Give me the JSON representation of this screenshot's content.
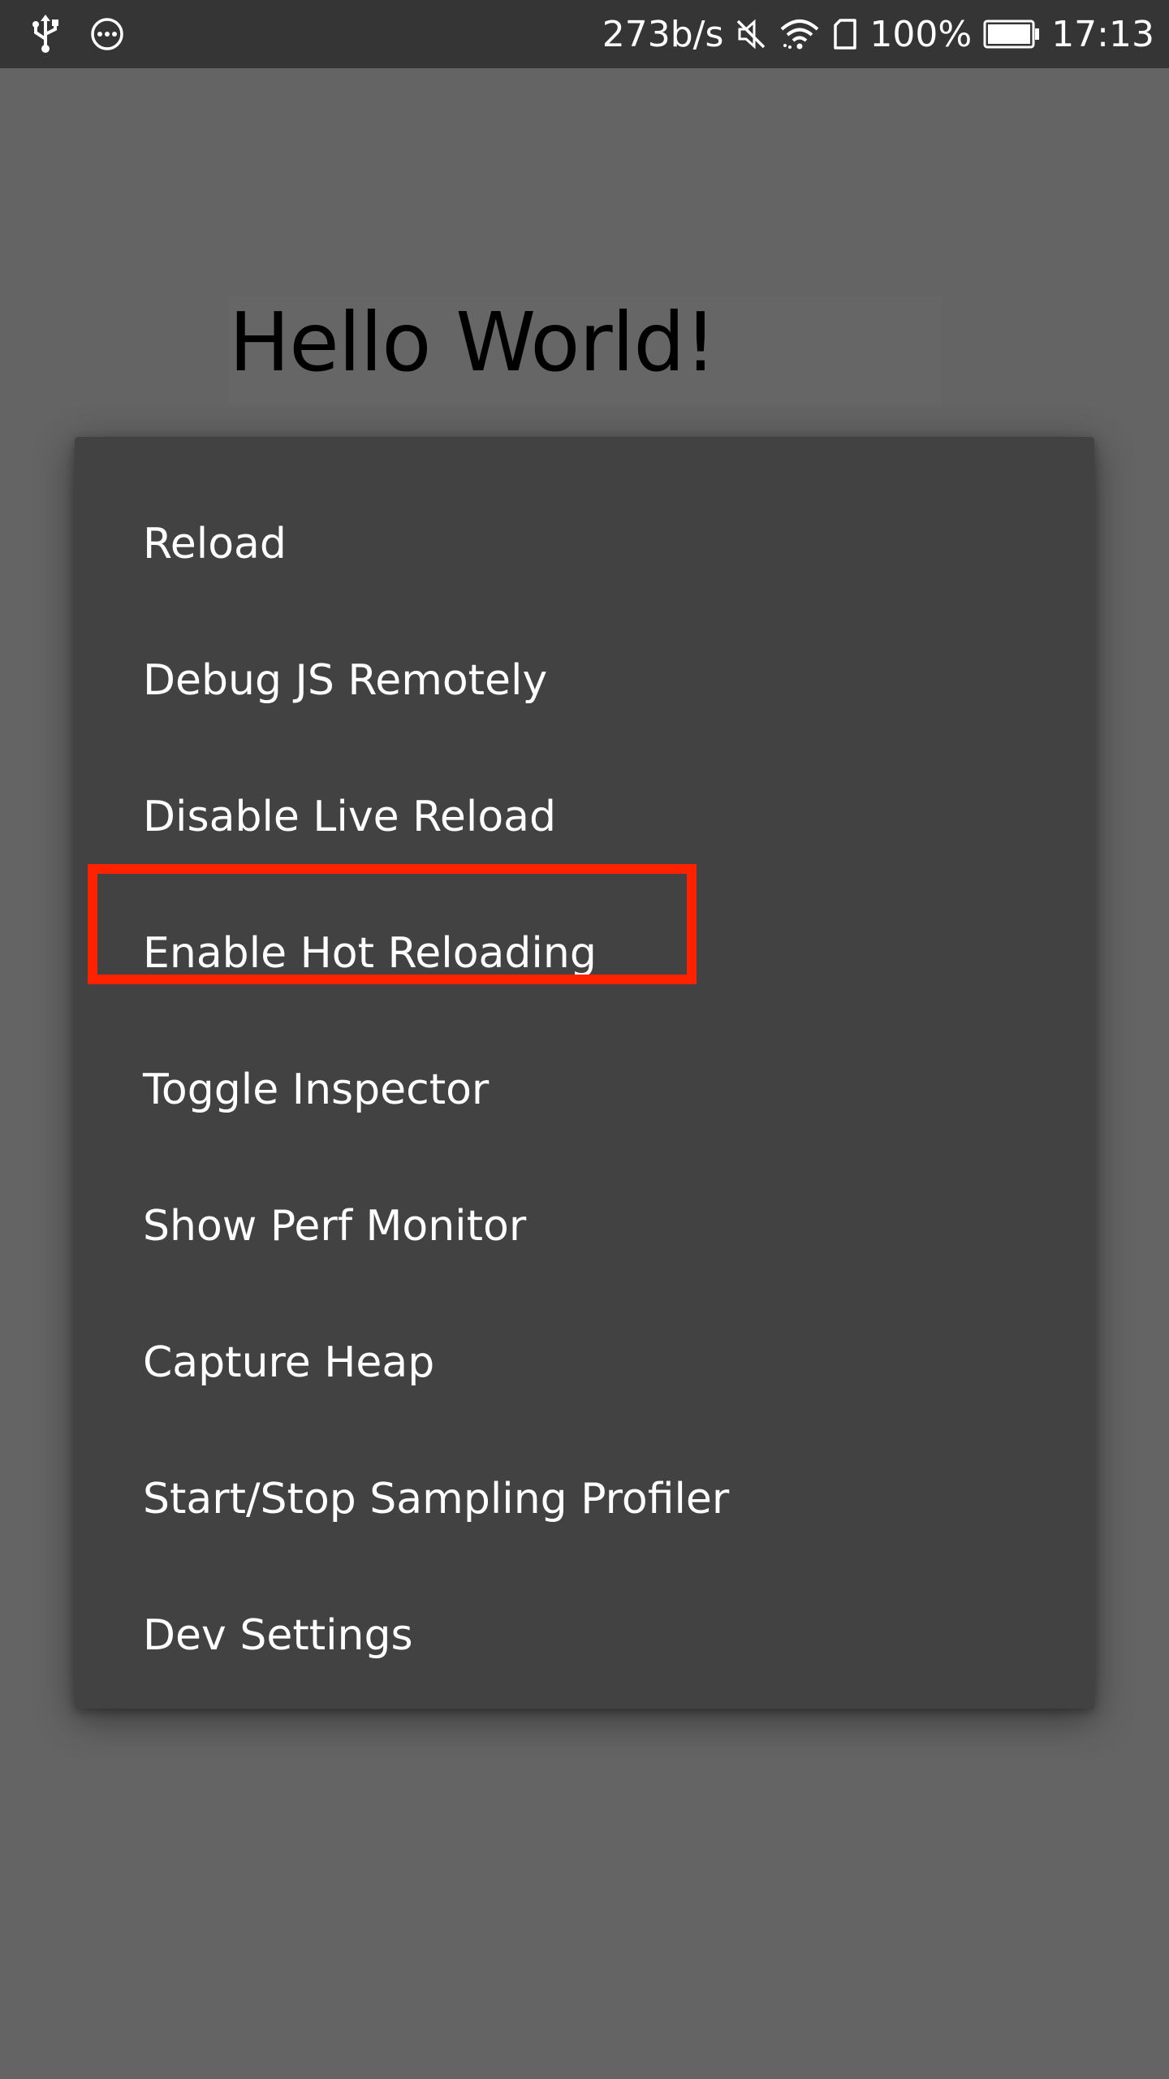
{
  "status_bar": {
    "left_icons": [
      "usb-icon",
      "more-dots-icon"
    ],
    "network_speed": "273b/s",
    "right_icons": [
      "mute-icon",
      "wifi-icon",
      "sim-card-icon"
    ],
    "battery_percent": "100%",
    "time": "17:13"
  },
  "app": {
    "title": "Hello World!"
  },
  "dev_menu": {
    "items": [
      {
        "label": "Reload"
      },
      {
        "label": "Debug JS Remotely"
      },
      {
        "label": "Disable Live Reload"
      },
      {
        "label": "Enable Hot Reloading"
      },
      {
        "label": "Toggle Inspector"
      },
      {
        "label": "Show Perf Monitor"
      },
      {
        "label": "Capture Heap"
      },
      {
        "label": "Start/Stop Sampling Profiler"
      },
      {
        "label": "Dev Settings"
      }
    ],
    "highlighted_item": "Enable Hot Reloading"
  },
  "colors": {
    "status_bar_bg": "#353535",
    "screen_bg": "#646464",
    "dialog_bg": "#424242",
    "menu_text": "#ffffff",
    "highlight": "#ff2200"
  }
}
